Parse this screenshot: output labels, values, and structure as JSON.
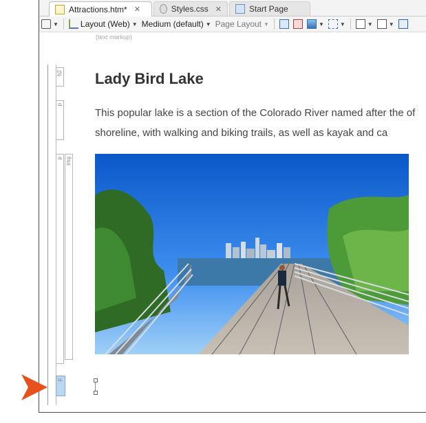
{
  "tabs": [
    {
      "label": "Attractions.htm*",
      "icon": "html-file-icon",
      "active": true
    },
    {
      "label": "Styles.css",
      "icon": "css-file-icon",
      "active": false
    },
    {
      "label": "Start Page",
      "icon": "start-page-icon",
      "active": false
    }
  ],
  "toolbar": {
    "layout_mode": "Layout (Web)",
    "medium": "Medium (default)",
    "page_layout": "Page Layout"
  },
  "structure_hint": "(text markup)",
  "structure_tags": {
    "h2": "h2",
    "p1": "p",
    "p2": "p",
    "img": "img",
    "p3": "p"
  },
  "document": {
    "heading": "Lady Bird Lake",
    "paragraph": "This popular lake is a section of the Colorado River named after the of shoreline, with walking and biking trails, as well as kayak and ca"
  },
  "colors": {
    "accent_arrow": "#e8501c",
    "selected_tag": "#b9d7f0",
    "heading": "#333333"
  }
}
